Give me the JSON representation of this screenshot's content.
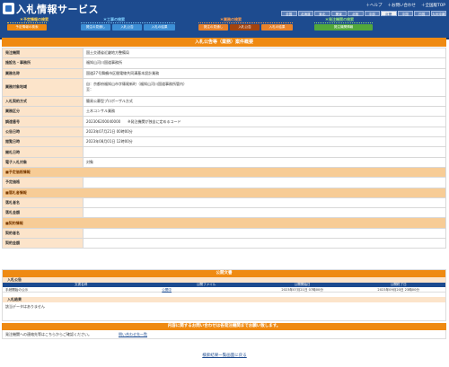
{
  "header": {
    "title": "入札情報サービス",
    "top_links": [
      "＋ヘルプ",
      "＋お問い合わせ",
      "＋全国版TOP"
    ],
    "regions": [
      {
        "label": "全国",
        "selected": false
      },
      {
        "label": "北海道",
        "selected": false
      },
      {
        "label": "東北",
        "selected": false
      },
      {
        "label": "関東",
        "selected": false
      },
      {
        "label": "北陸",
        "selected": false
      },
      {
        "label": "中部",
        "selected": false
      },
      {
        "label": "近畿",
        "selected": true
      },
      {
        "label": "中国",
        "selected": false
      },
      {
        "label": "四国",
        "selected": false
      },
      {
        "label": "九州沖縄",
        "selected": false
      }
    ],
    "nav_groups": [
      {
        "heading": "＊予定情報の検索",
        "buttons": [
          "予定情報の検索"
        ]
      },
      {
        "heading": "＊工事の検索",
        "buttons": [
          "発注の見通し",
          "入札公告",
          "入札の結果"
        ]
      },
      {
        "heading": "＊業務の検索",
        "buttons": [
          "発注の見通し",
          "入札公告",
          "入札の結果"
        ]
      },
      {
        "heading": "＊発注機関の検索",
        "buttons": [
          "発注機関情報"
        ]
      }
    ]
  },
  "main": {
    "title": "入札公告等（業務）案件概要",
    "rows": [
      {
        "label": "発注機関",
        "value": "国土交通省近畿地方整備局"
      },
      {
        "label": "施設名・事務所",
        "value": "福知山河川国道事務所"
      },
      {
        "label": "業務名称",
        "value": "国道27号舞鶴市区間電線共同溝基本設計業務"
      },
      {
        "label": "業務対象地域",
        "value": "自：京都府福知山市字篠尾新町（福知山河川国道事務所管内）\n至：",
        "tall": true
      },
      {
        "label": "入札契約方式",
        "value": "簡易公募型プロポーザル方式"
      },
      {
        "label": "業務区分",
        "value": "土木コンサル業務"
      },
      {
        "label": "調達番号",
        "value": "202306200040000　　※発注機関が独自に定めるコード"
      },
      {
        "label": "公告日時",
        "value": "2023年07月21日 00時00分"
      },
      {
        "label": "閲覧日時",
        "value": "2023年08月01日 12時00分"
      },
      {
        "label": "開札日時",
        "value": ""
      },
      {
        "label": "電子入札対象",
        "value": "対象"
      },
      {
        "section": "■予定価格情報"
      },
      {
        "label": "予定価格",
        "value": ""
      },
      {
        "section": "■落札者情報"
      },
      {
        "label": "落札者名",
        "value": ""
      },
      {
        "label": "落札金額",
        "value": ""
      },
      {
        "section": "■契約情報"
      },
      {
        "label": "契約者名",
        "value": ""
      },
      {
        "label": "契約金額",
        "value": ""
      }
    ]
  },
  "documents": {
    "title": "公開文書",
    "section1": "入札公告",
    "headers": [
      "文書名称",
      "公開ファイル",
      "公開開始日",
      "公開終了日"
    ],
    "rows": [
      {
        "name": "手続開始の公示",
        "file": "公開中",
        "start": "2023年07月21日 07時00分",
        "end": "2023年09月20日 23時00分"
      }
    ],
    "section2": "入札結果",
    "no_data": "該当データはありません"
  },
  "contact": {
    "title": "内容に関するお問い合わせは各発注機関までお願い致します。",
    "text": "発注機関への連絡先等はこちらからご確認ください。",
    "link": "問い合わせ先一覧"
  },
  "back_link": "検索結果一覧画面に戻る",
  "colors": {
    "header_blue": "#1d4b8f",
    "accent_orange": "#ef8a12",
    "label_bg": "#fce4ca",
    "section_bg": "#f7cc96"
  }
}
